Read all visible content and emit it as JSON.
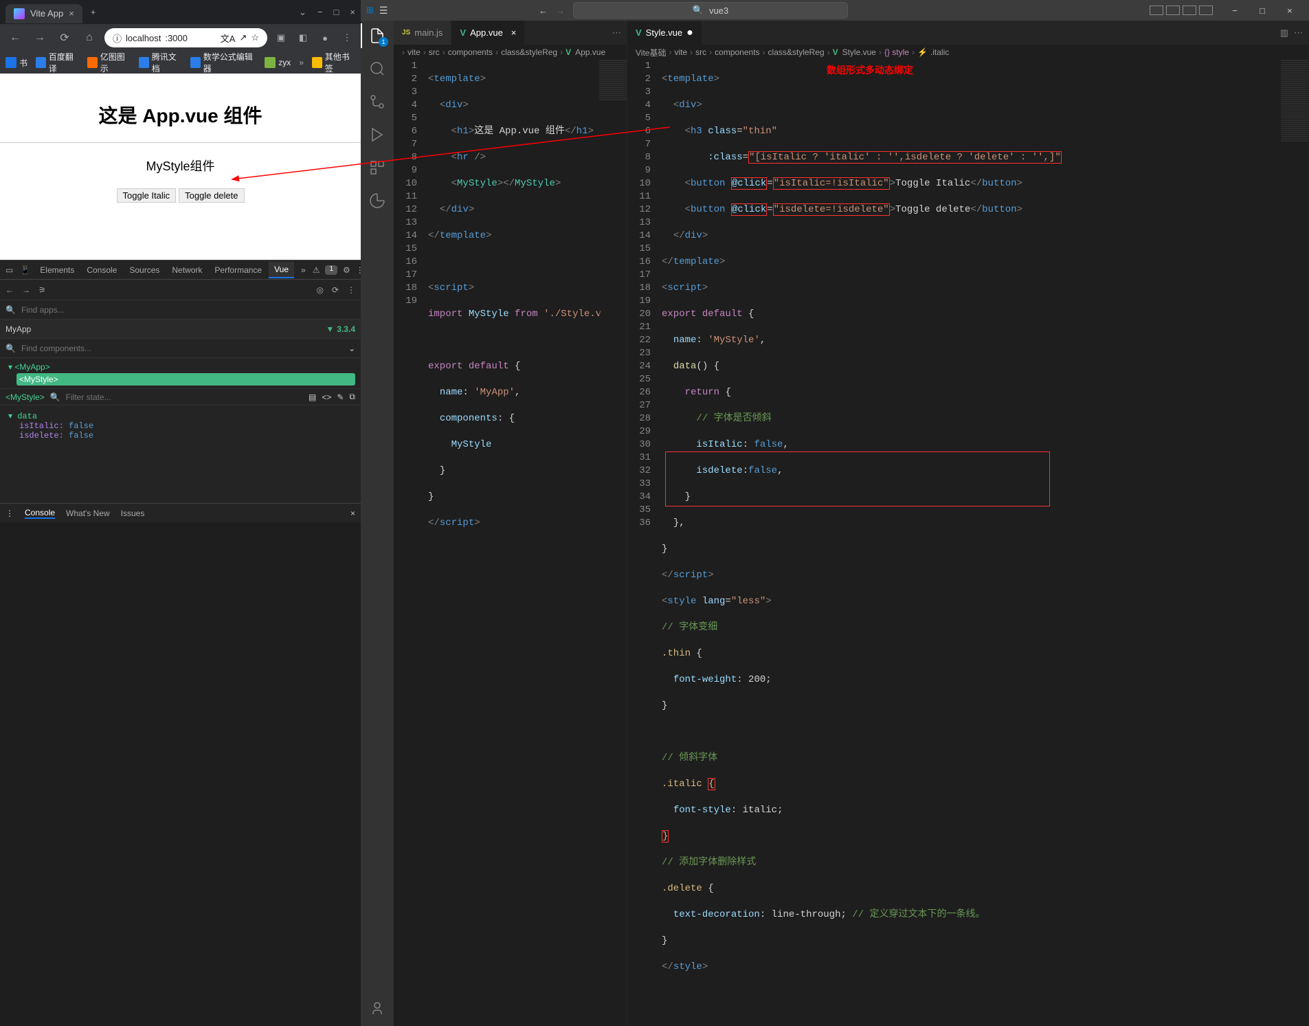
{
  "browser": {
    "tab_title": "Vite App",
    "url_prefix": "localhost",
    "url_port": ":3000",
    "bookmarks": [
      "书",
      "百度翻译",
      "亿图图示",
      "腾讯文档",
      "数学公式编辑器",
      "zyx",
      "其他书签"
    ],
    "window_controls": [
      "−",
      "□",
      "×"
    ]
  },
  "page": {
    "heading": "这是 App.vue 组件",
    "subtitle": "MyStyle组件",
    "btn_italic": "Toggle Italic",
    "btn_delete": "Toggle delete"
  },
  "devtools": {
    "tabs": [
      "Elements",
      "Console",
      "Sources",
      "Network",
      "Performance",
      "Vue"
    ],
    "active_tab": "Vue",
    "warnings": "1",
    "find_apps": "Find apps...",
    "app_name": "MyApp",
    "vue_version": "3.3.4",
    "find_components": "Find components...",
    "tree_root": "<MyApp>",
    "tree_child": "<MyStyle>",
    "selected_component": "<MyStyle>",
    "filter_state": "Filter state...",
    "state_section": "data",
    "state_items": [
      {
        "key": "isItalic",
        "value": "false"
      },
      {
        "key": "isdelete",
        "value": "false"
      }
    ],
    "footer": [
      "Console",
      "What's New",
      "Issues"
    ]
  },
  "vscode": {
    "search_placeholder": "vue3",
    "activity_badge": "1",
    "group1": {
      "tabs": [
        {
          "icon": "JS",
          "label": "main.js",
          "active": false
        },
        {
          "icon": "V",
          "label": "App.vue",
          "active": true
        }
      ],
      "breadcrumbs": [
        "vite",
        "src",
        "components",
        "class&styleReg",
        "App.vue"
      ]
    },
    "group2": {
      "tabs": [
        {
          "icon": "V",
          "label": "Style.vue",
          "active": true,
          "dirty": true
        }
      ],
      "breadcrumbs": [
        "Vite基础",
        "vite",
        "src",
        "components",
        "class&styleReg",
        "Style.vue",
        "{} style",
        ".italic"
      ]
    },
    "annotation": "数组形式多动态绑定"
  },
  "chart_data": {
    "type": "table",
    "title": "Vue component state",
    "categories": [
      "isItalic",
      "isdelete"
    ],
    "values": [
      "false",
      "false"
    ]
  }
}
